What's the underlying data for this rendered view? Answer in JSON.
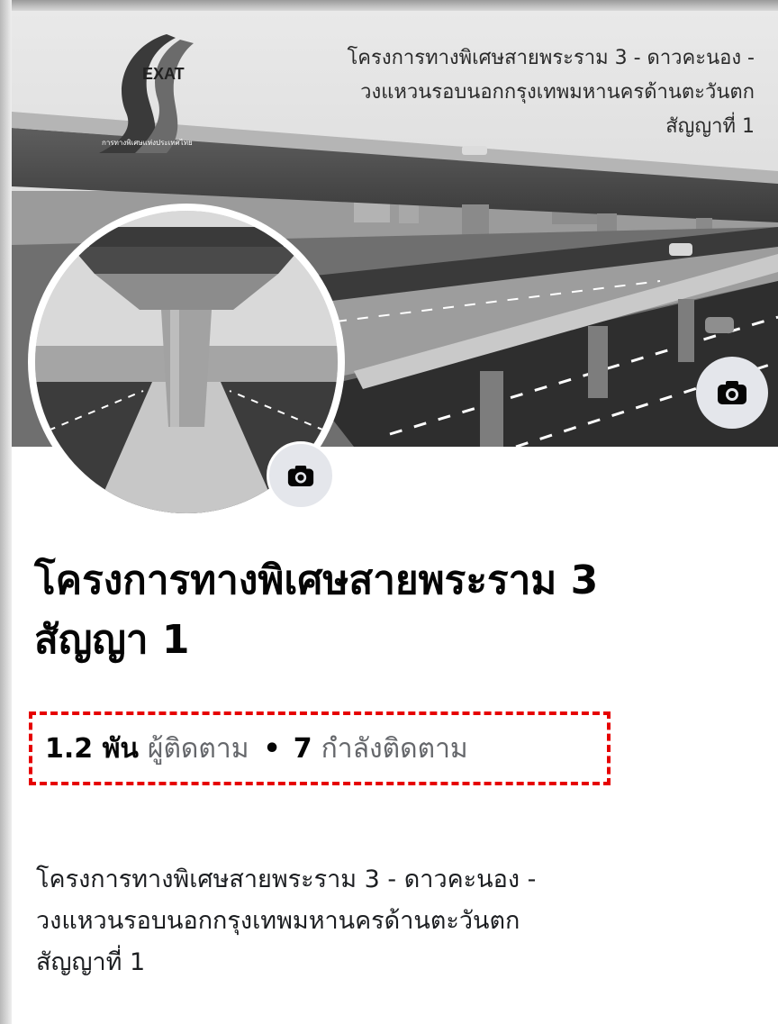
{
  "cover": {
    "logo_text": "EXAT",
    "logo_subtitle": "การทางพิเศษแห่งประเทศไทย",
    "title_lines": [
      "โครงการทางพิเศษสายพระราม 3 - ดาวคะนอง -",
      "วงแหวนรอบนอกกรุงเทพมหานครด้านตะวันตก",
      "สัญญาที่ 1"
    ],
    "camera_icon": "camera-icon"
  },
  "avatar": {
    "camera_icon": "camera-icon"
  },
  "page": {
    "title_lines": [
      "โครงการทางพิเศษสายพระราม 3",
      "สัญญา 1"
    ]
  },
  "stats": {
    "followers_count": "1.2 พัน",
    "followers_label": "ผู้ติดตาม",
    "separator": "•",
    "following_count": "7",
    "following_label": "กำลังติดตาม",
    "highlight_color": "#e60000"
  },
  "about": {
    "lines": [
      "โครงการทางพิเศษสายพระราม 3 - ดาวคะนอง -",
      "วงแหวนรอบนอกกรุงเทพมหานครด้านตะวันตก",
      "สัญญาที่ 1"
    ]
  }
}
